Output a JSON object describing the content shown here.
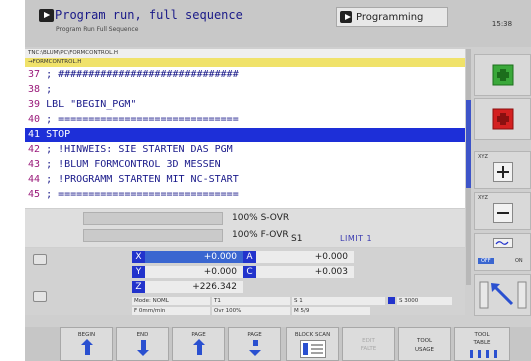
{
  "header": {
    "mode_title": "Program run, full sequence",
    "mode_subtitle": "Program Run Full Sequence",
    "other_mode": "Programming",
    "clock": "15:38"
  },
  "program": {
    "path": "TNC:\\BLUM\\PC\\FORMCONTROL.H",
    "tab": "→FORMCONTROL.H",
    "lines": [
      {
        "num": "37",
        "text": " ; ##############################"
      },
      {
        "num": "38",
        "text": " ;"
      },
      {
        "num": "39",
        "text": " LBL \"BEGIN_PGM\""
      },
      {
        "num": "40",
        "text": " ; =============================="
      },
      {
        "num": "41",
        "text": " STOP"
      },
      {
        "num": "42",
        "text": " ; !HINWEIS: SIE STARTEN DAS PGM"
      },
      {
        "num": "43",
        "text": " ; !BLUM FORMCONTROL 3D MESSEN"
      },
      {
        "num": "44",
        "text": " ; !PROGRAMM STARTEN MIT NC-START"
      },
      {
        "num": "45",
        "text": " ; =============================="
      }
    ]
  },
  "override": {
    "s_ovr": "100% S-OVR",
    "f_ovr": "100% F-OVR",
    "spindle": "S1",
    "limit": "LIMIT 1"
  },
  "positions": {
    "x_label": "X",
    "x_value": "+0.000",
    "y_label": "Y",
    "y_value": "+0.000",
    "z_label": "Z",
    "z_value": "+226.342",
    "a_label": "A",
    "a_value": "+0.000",
    "c_label": "C",
    "c_value": "+0.003"
  },
  "info": {
    "mode": "Mode: NOML",
    "t_field": "T1",
    "s_field": "S 1",
    "s_speed": "S 3000",
    "feed": "F 0mm/min",
    "ovr": "Ovr 100%",
    "m_field": "M 5/9"
  },
  "right_panel": {
    "xyz_1": "XYZ",
    "xyz_2": "XYZ",
    "off": "OFF",
    "on": "ON"
  },
  "softkeys": {
    "begin": "BEGIN",
    "end": "END",
    "page_1": "PAGE",
    "page_2": "PAGE",
    "block_scan": "BLOCK SCAN",
    "edit_1": "EDIT",
    "edit_2": "FALTE",
    "tool_usage_1": "TOOL",
    "tool_usage_2": "USAGE",
    "tool_table_1": "TOOL",
    "tool_table_2": "TABLE"
  },
  "colors": {
    "selection": "#1d2fd8",
    "axis": "#2233cc",
    "program_tab": "#f0e26a",
    "green_button": "#3aa83a",
    "red_button": "#d42020"
  }
}
